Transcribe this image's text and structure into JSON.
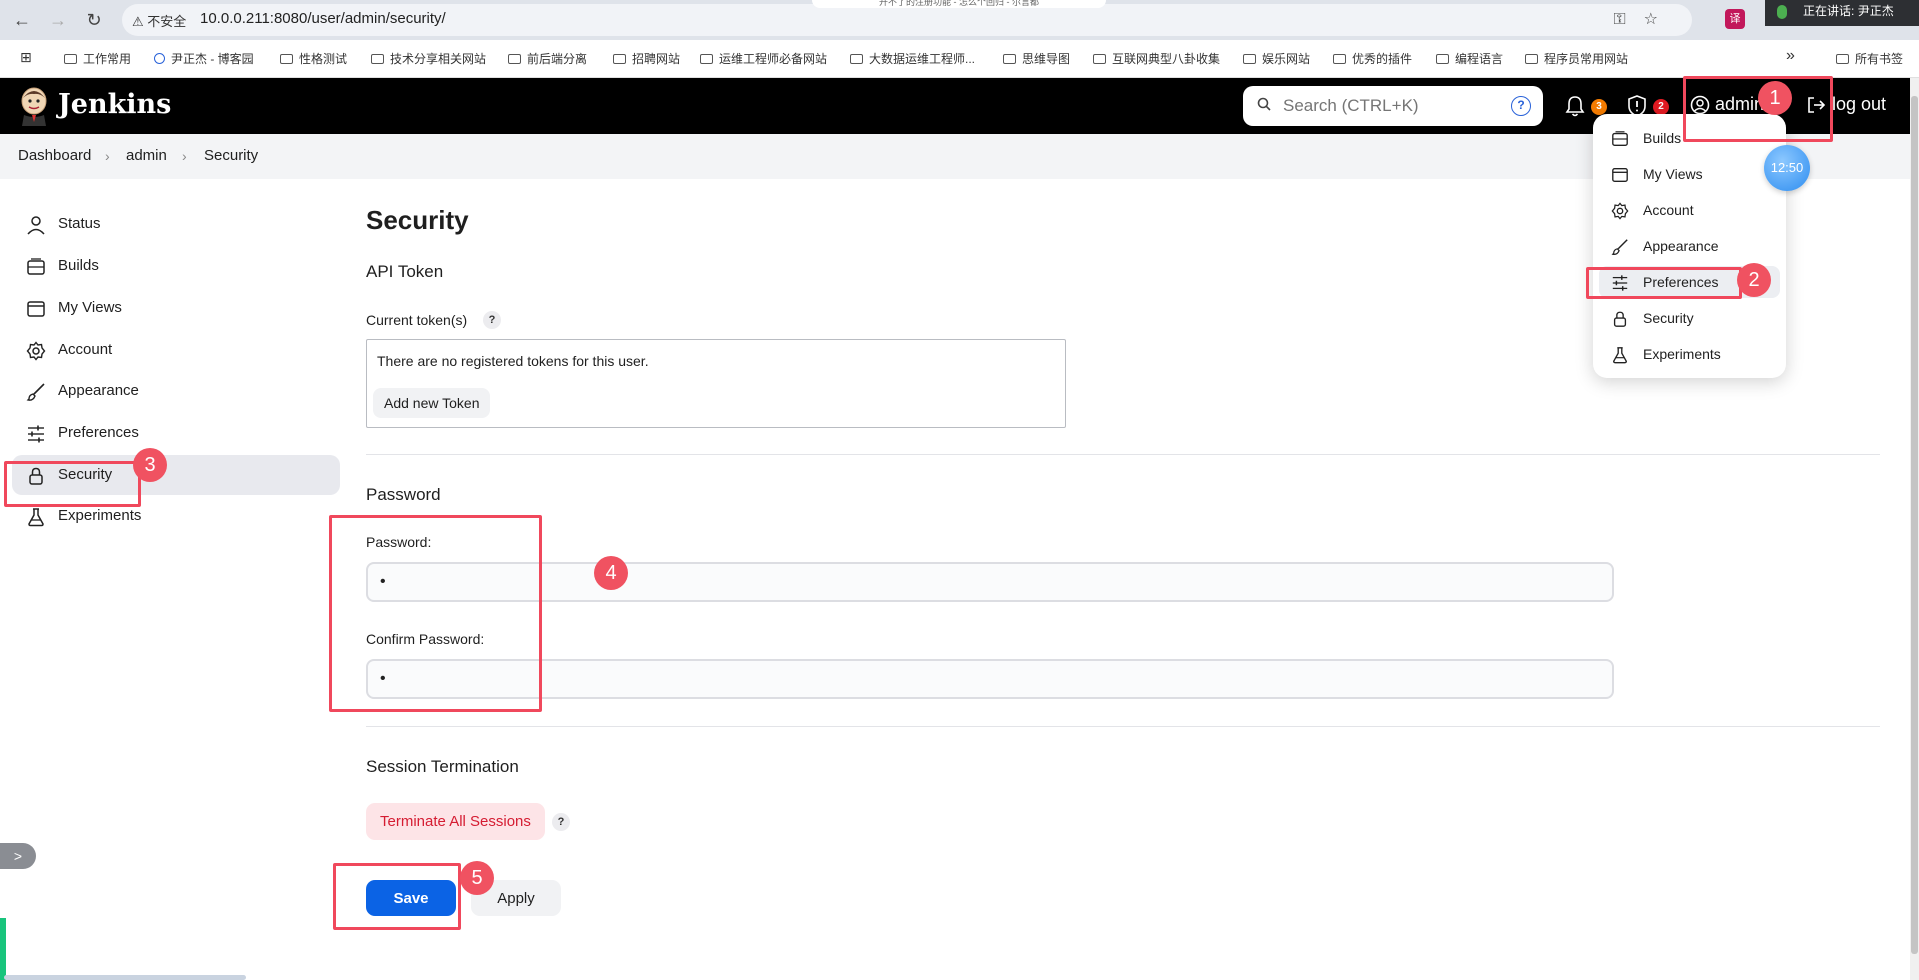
{
  "browser": {
    "url": "10.0.0.211:8080/user/admin/security/",
    "insecure_label": "不安全",
    "tab_title_fragment": "开不了的注册功能 - 怎么个回归 - 尔言都",
    "speaking_label": "正在讲话:",
    "speaking_name": "尹正杰",
    "ext_label": "译",
    "bookmarks": [
      "工作常用",
      "尹正杰 - 博客园",
      "性格测试",
      "技术分享相关网站",
      "前后端分离",
      "招聘网站",
      "运维工程师必备网站",
      "大数据运维工程师...",
      "思维导图",
      "互联网典型八卦收集",
      "娱乐网站",
      "优秀的插件",
      "编程语言",
      "程序员常用网站"
    ],
    "more_bookmarks": "»",
    "all_bookmarks": "所有书签"
  },
  "header": {
    "title": "Jenkins",
    "search_placeholder": "Search (CTRL+K)",
    "search_help": "?",
    "notifications_count": "3",
    "security_count": "2",
    "user_label": "admin",
    "logout_label": "log out",
    "colors": {
      "notif_badge": "#f57c00",
      "security_badge": "#e31b23"
    }
  },
  "breadcrumb": [
    "Dashboard",
    "admin",
    "Security"
  ],
  "sidebar": {
    "items": [
      {
        "label": "Status",
        "icon": "person-icon"
      },
      {
        "label": "Builds",
        "icon": "builds-icon"
      },
      {
        "label": "My Views",
        "icon": "window-icon"
      },
      {
        "label": "Account",
        "icon": "gear-icon"
      },
      {
        "label": "Appearance",
        "icon": "brush-icon"
      },
      {
        "label": "Preferences",
        "icon": "sliders-icon"
      },
      {
        "label": "Security",
        "icon": "lock-icon",
        "active": true
      },
      {
        "label": "Experiments",
        "icon": "flask-icon"
      }
    ]
  },
  "main": {
    "title": "Security",
    "api_token": {
      "section_title": "API Token",
      "current_label": "Current token(s)",
      "help": "?",
      "empty_text": "There are no registered tokens for this user.",
      "add_button": "Add new Token"
    },
    "password": {
      "section_title": "Password",
      "password_label": "Password:",
      "password_value": "•",
      "confirm_label": "Confirm Password:",
      "confirm_value": "•"
    },
    "session": {
      "section_title": "Session Termination",
      "terminate_button": "Terminate All Sessions",
      "help": "?"
    },
    "save_label": "Save",
    "apply_label": "Apply"
  },
  "user_menu": {
    "items": [
      {
        "label": "Builds",
        "icon": "builds-icon"
      },
      {
        "label": "My Views",
        "icon": "window-icon"
      },
      {
        "label": "Account",
        "icon": "gear-icon"
      },
      {
        "label": "Appearance",
        "icon": "brush-icon"
      },
      {
        "label": "Preferences",
        "icon": "sliders-icon",
        "highlighted": true
      },
      {
        "label": "Security",
        "icon": "lock-icon"
      },
      {
        "label": "Experiments",
        "icon": "flask-icon"
      }
    ]
  },
  "annotations": [
    "1",
    "2",
    "3",
    "4",
    "5"
  ],
  "clock_time": "12:50",
  "sidebar_toggle": ">"
}
